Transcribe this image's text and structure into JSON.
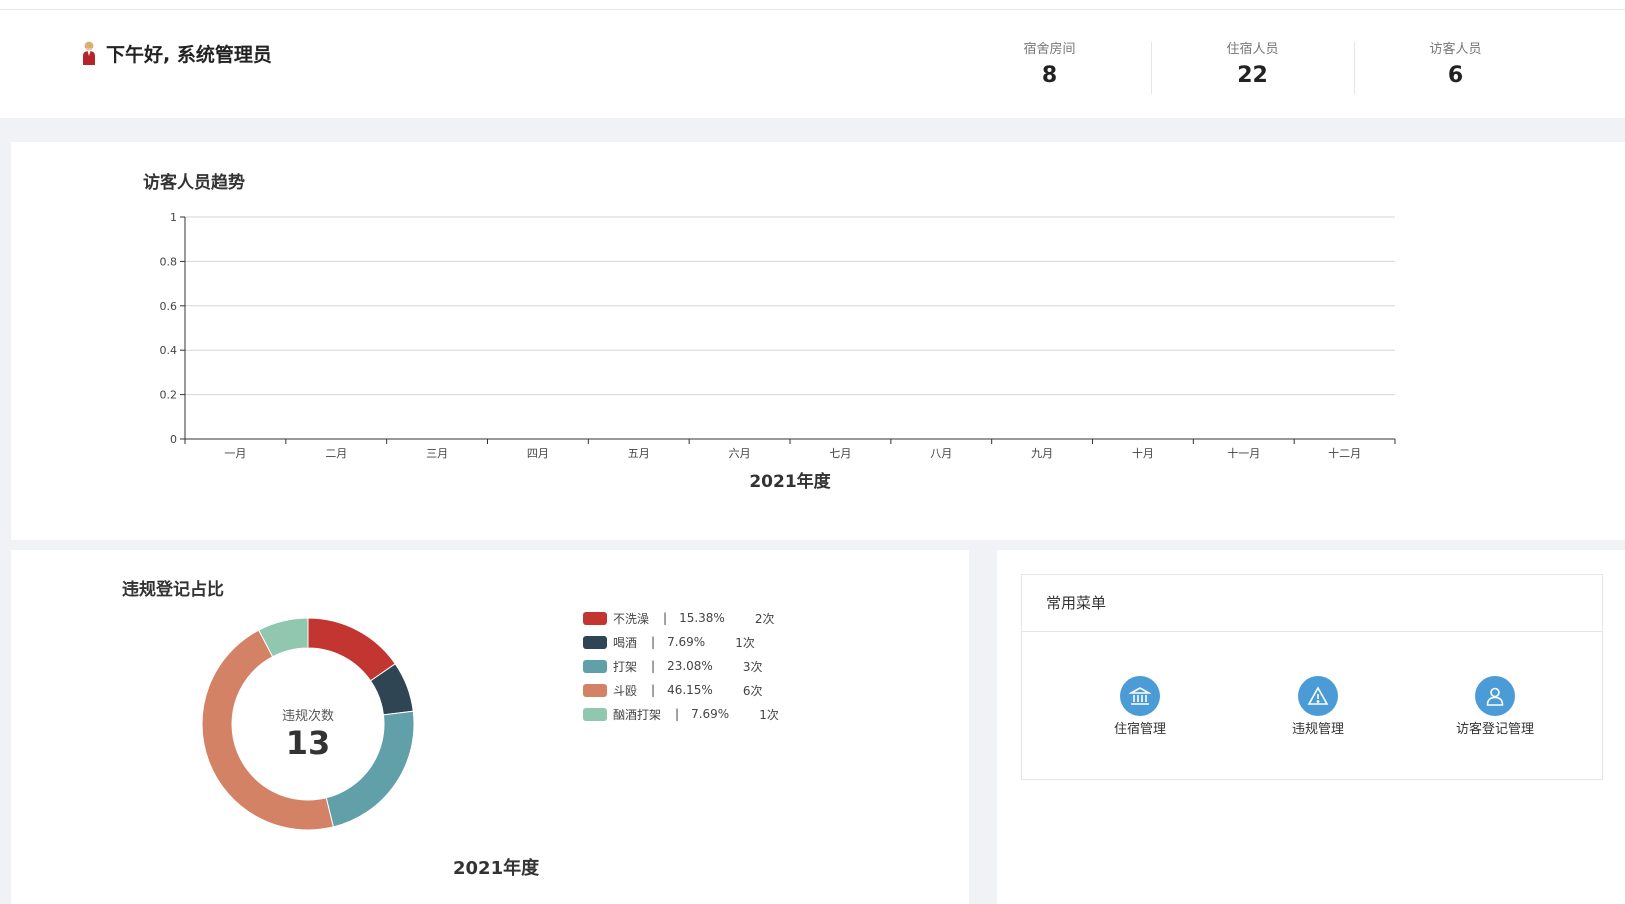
{
  "header": {
    "greeting": "下午好, 系统管理员",
    "stats": [
      {
        "label": "宿舍房间",
        "value": "8"
      },
      {
        "label": "住宿人员",
        "value": "22"
      },
      {
        "label": "访客人员",
        "value": "6"
      }
    ]
  },
  "trend": {
    "title": "访客人员趋势",
    "xlabel": "2021年度"
  },
  "violation": {
    "title": "违规登记占比",
    "center_label": "违规次数",
    "center_value": "13",
    "xlabel": "2021年度",
    "legend": [
      {
        "name": "不洗澡",
        "sep": "|",
        "percent": "15.38%",
        "count": "2次"
      },
      {
        "name": "喝酒",
        "sep": "|",
        "percent": "7.69%",
        "count": "1次"
      },
      {
        "name": "打架",
        "sep": "|",
        "percent": "23.08%",
        "count": "3次"
      },
      {
        "name": "斗殴",
        "sep": "|",
        "percent": "46.15%",
        "count": "6次"
      },
      {
        "name": "酗酒打架",
        "sep": "|",
        "percent": "7.69%",
        "count": "1次"
      }
    ]
  },
  "menu": {
    "title": "常用菜单",
    "items": [
      {
        "label": "住宿管理",
        "icon": "bank-icon"
      },
      {
        "label": "违规管理",
        "icon": "warning-icon"
      },
      {
        "label": "访客登记管理",
        "icon": "user-icon"
      }
    ]
  },
  "colors": {
    "series": [
      "#c23531",
      "#2f4554",
      "#61a0a8",
      "#d48265",
      "#91c7ae"
    ],
    "menu_icon_bg": "#4a9bd6"
  },
  "chart_data": [
    {
      "type": "line",
      "title": "访客人员趋势",
      "xlabel": "2021年度",
      "ylabel": "",
      "categories": [
        "一月",
        "二月",
        "三月",
        "四月",
        "五月",
        "六月",
        "七月",
        "八月",
        "九月",
        "十月",
        "十一月",
        "十二月"
      ],
      "series": [
        {
          "values": []
        }
      ],
      "yticks": [
        "0",
        "0.2",
        "0.4",
        "0.6",
        "0.8",
        "1"
      ],
      "ylim": [
        0,
        1
      ],
      "grid": true
    },
    {
      "type": "pie",
      "title": "违规登记占比",
      "donut": true,
      "categories": [
        "不洗澡",
        "喝酒",
        "打架",
        "斗殴",
        "酗酒打架"
      ],
      "values": [
        2,
        1,
        3,
        6,
        1
      ],
      "percentages": [
        15.38,
        7.69,
        23.08,
        46.15,
        7.69
      ],
      "total": 13,
      "legend_position": "right"
    }
  ]
}
